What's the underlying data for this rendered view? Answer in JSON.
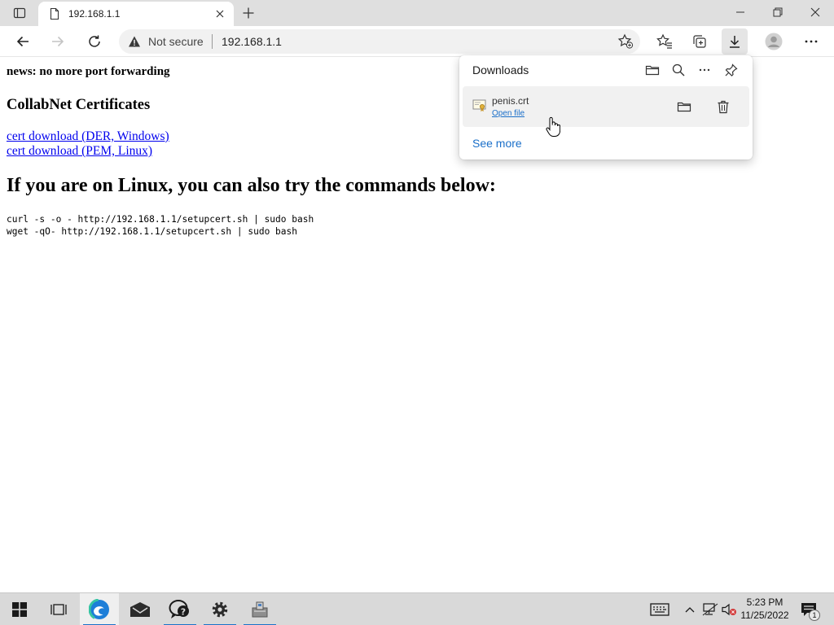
{
  "browser": {
    "tab": {
      "title": "192.168.1.1"
    },
    "address_bar": {
      "security_label": "Not secure",
      "url": "192.168.1.1"
    }
  },
  "page": {
    "news": "news: no more port forwarding",
    "certs_heading": "CollabNet Certificates",
    "links": [
      {
        "label": "cert download (DER, Windows)"
      },
      {
        "label": "cert download (PEM, Linux)"
      }
    ],
    "linux_heading": "If you are on Linux, you can also try the commands below:",
    "commands": [
      "curl -s -o - http://192.168.1.1/setupcert.sh | sudo bash",
      "wget -qO- http://192.168.1.1/setupcert.sh | sudo bash"
    ]
  },
  "downloads": {
    "title": "Downloads",
    "item": {
      "filename": "penis.crt",
      "open_label": "Open file"
    },
    "see_more": "See more"
  },
  "taskbar": {
    "time": "5:23 PM",
    "date": "11/25/2022",
    "notification_count": "1"
  },
  "colors": {
    "accent": "#1a73c9",
    "link": "#0000ee",
    "download_link": "#1a6fc9"
  },
  "icons": [
    "tab-actions-icon",
    "page-icon",
    "close-icon",
    "plus-icon",
    "minimize-icon",
    "restore-icon",
    "back-icon",
    "forward-icon",
    "refresh-icon",
    "warning-icon",
    "star-plus-icon",
    "favorites-icon",
    "collections-icon",
    "download-icon",
    "profile-icon",
    "more-icon",
    "folder-icon",
    "search-icon",
    "pin-icon",
    "certificate-file-icon",
    "trash-icon",
    "windows-icon",
    "task-view-icon",
    "edge-icon",
    "mail-icon",
    "feedback-icon",
    "settings-icon",
    "app-icon",
    "keyboard-icon",
    "chevron-up-icon",
    "network-icon",
    "volume-muted-icon",
    "notification-icon",
    "hand-cursor-icon"
  ]
}
